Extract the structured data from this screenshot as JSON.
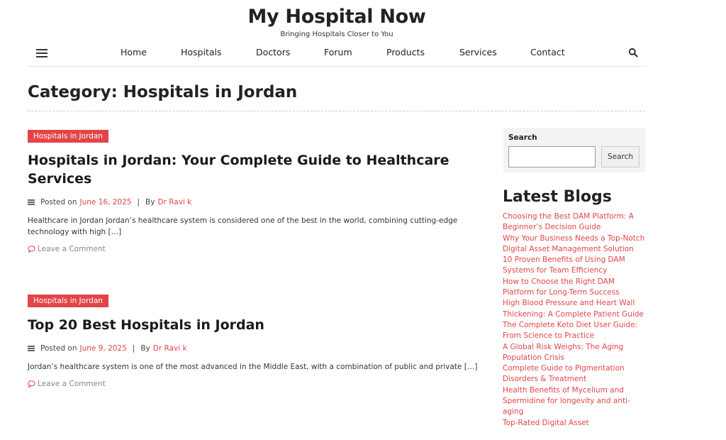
{
  "site": {
    "title": "My Hospital Now",
    "tagline": "Bringing Hospitals Closer to You"
  },
  "nav": {
    "items": [
      "Home",
      "Hospitals",
      "Doctors",
      "Forum",
      "Products",
      "Services",
      "Contact"
    ]
  },
  "category": {
    "title": "Category: Hospitals in Jordan"
  },
  "posts": [
    {
      "badge": "Hospitals in Jordan",
      "title": "Hospitals in Jordan: Your Complete Guide to Healthcare Services",
      "posted_on_label": "Posted on",
      "date": "June 16, 2025",
      "separator": "|",
      "by_label": "By",
      "author": "Dr Ravi k",
      "excerpt": "Healthcare in Jordan Jordan’s healthcare system is considered one of the best in the world, combining cutting-edge technology with high […]",
      "comment_link": "Leave a Comment"
    },
    {
      "badge": "Hospitals in Jordan",
      "title": "Top 20 Best Hospitals in Jordan",
      "posted_on_label": "Posted on",
      "date": "June 9, 2025",
      "separator": "|",
      "by_label": "By",
      "author": "Dr Ravi k",
      "excerpt": "Jordan’s healthcare system is one of the most advanced in the Middle East, with a combination of public and private […]",
      "comment_link": "Leave a Comment"
    }
  ],
  "sidebar": {
    "search": {
      "label": "Search",
      "placeholder": "",
      "button": "Search"
    },
    "latest_blogs": {
      "title": "Latest Blogs",
      "items": [
        "Choosing the Best DAM Platform: A Beginner’s Decision Guide",
        "Why Your Business Needs a Top-Notch Digital Asset Management Solution",
        "10 Proven Benefits of Using DAM Systems for Team Efficiency",
        "How to Choose the Right DAM Platform for Long-Term Success",
        "High Blood Pressure and Heart Wall Thickening: A Complete Patient Guide",
        "The Complete Keto Diet User Guide: From Science to Practice",
        "A Global Risk Weighs: The Aging Population Crisis",
        "Complete Guide to Pigmentation Disorders & Treatment",
        "Health Benefits of Mycelium and Spermidine for longevity and anti-aging",
        "Top-Rated Digital Asset"
      ]
    }
  },
  "colors": {
    "accent": "#e24548",
    "text": "#222222",
    "widget_bg": "#f3f3f3"
  }
}
